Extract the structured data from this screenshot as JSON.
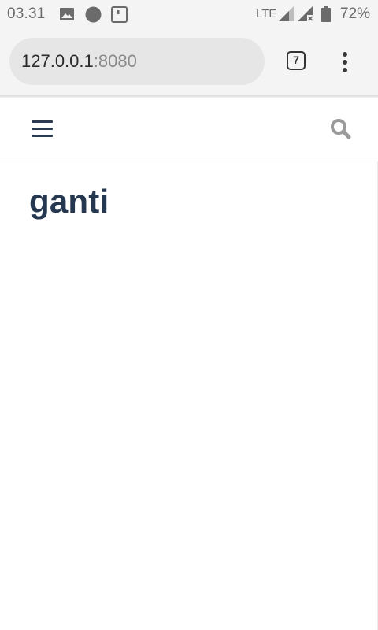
{
  "status_bar": {
    "time": "03.31",
    "network": "LTE",
    "battery": "72%",
    "icons": [
      "image-icon",
      "circle-icon",
      "sim-icon",
      "signal-icon",
      "signal-no-data-icon",
      "battery-icon"
    ]
  },
  "browser": {
    "url_host": "127.0.0.1",
    "url_port": ":8080",
    "tab_count": "7",
    "menu_icon": "more-vert-icon"
  },
  "site_header": {
    "menu_icon": "hamburger-menu-icon",
    "search_icon": "search-icon"
  },
  "main": {
    "title": "ganti"
  },
  "colors": {
    "title": "#26384f",
    "hamburger": "#2a3a51",
    "search_icon": "#9a9a9a",
    "status_bar_bg": "#f4f4f4",
    "url_box_bg": "#e6e6e6"
  }
}
